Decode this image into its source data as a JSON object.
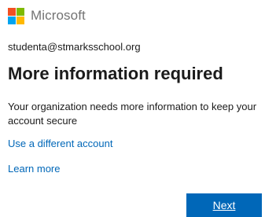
{
  "brand": {
    "name": "Microsoft",
    "logo_colors": [
      "#f25022",
      "#7fba00",
      "#00a4ef",
      "#ffb900"
    ]
  },
  "account": {
    "email": "studenta@stmarksschool.org"
  },
  "heading": {
    "title": "More information required",
    "description": "Your organization needs more information to keep your account secure"
  },
  "links": {
    "different_account": "Use a different account",
    "learn_more": "Learn more"
  },
  "actions": {
    "next_label": "Next"
  },
  "colors": {
    "accent": "#0067b8",
    "text": "#1b1b1b",
    "brand_text": "#737373"
  }
}
